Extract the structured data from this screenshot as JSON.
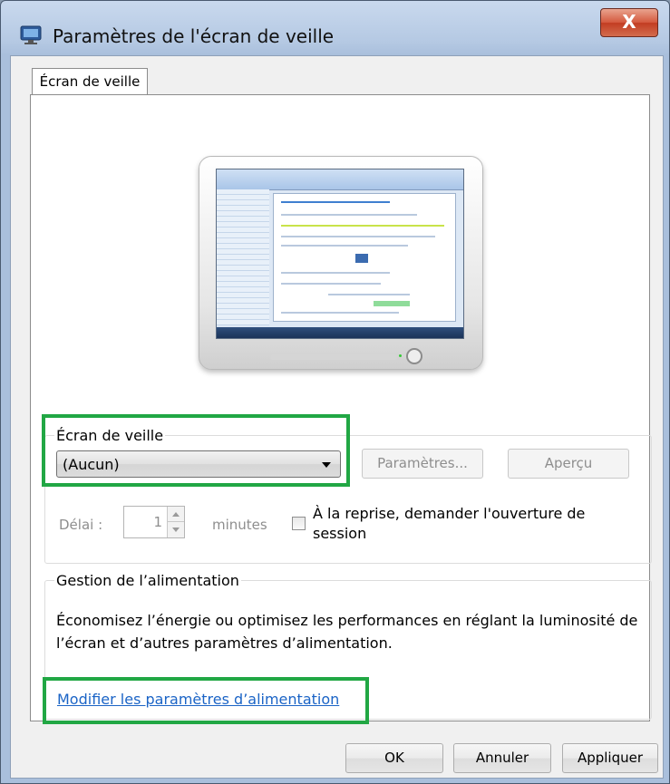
{
  "window": {
    "title": "Paramètres de l'écran de veille",
    "close_label": "X",
    "app_icon": "display-settings-icon"
  },
  "tabs": [
    {
      "label": "Écran de veille",
      "selected": true
    }
  ],
  "preview": {
    "description_icon": "monitor-preview-icon"
  },
  "screensaver": {
    "group_label": "Écran de veille",
    "selected_option": "(Aucun)",
    "settings_button": "Paramètres...",
    "preview_button": "Aperçu",
    "delay_label": "Délai :",
    "delay_value": "1",
    "minutes_label": "minutes",
    "resume_checkbox_label": "À la reprise, demander l'ouverture de session",
    "resume_checked": false
  },
  "power": {
    "group_label": "Gestion de l’alimentation",
    "description": "Économisez l’énergie ou optimisez les performances en réglant la luminosité de l’écran et d’autres paramètres d’alimentation.",
    "link_label": "Modifier les paramètres d’alimentation"
  },
  "buttons": {
    "ok": "OK",
    "cancel": "Annuler",
    "apply": "Appliquer"
  },
  "colors": {
    "highlight": "#21a744",
    "link": "#1b64c6",
    "close_button": "#c94a2f"
  }
}
